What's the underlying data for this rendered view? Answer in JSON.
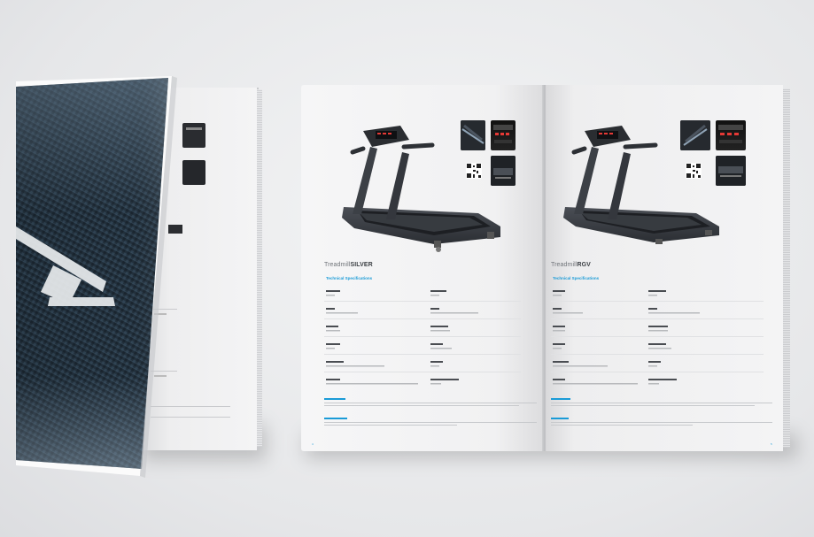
{
  "scene": {
    "description_hidden": ""
  },
  "left_page": {
    "model_prefix": "Treadmill",
    "model_name": "SILVER",
    "specs_heading": "Technical Specifications",
    "page_number": "4"
  },
  "right_page": {
    "model_prefix": "Treadmill",
    "model_name": "RGV",
    "specs_heading": "Technical Specifications",
    "page_number": "5"
  },
  "colors": {
    "accent": "#1a9bd7",
    "machine": "#3a3d42"
  },
  "icons": {
    "treadmill": "treadmill-illustration",
    "qr": "qr-code-icon"
  }
}
